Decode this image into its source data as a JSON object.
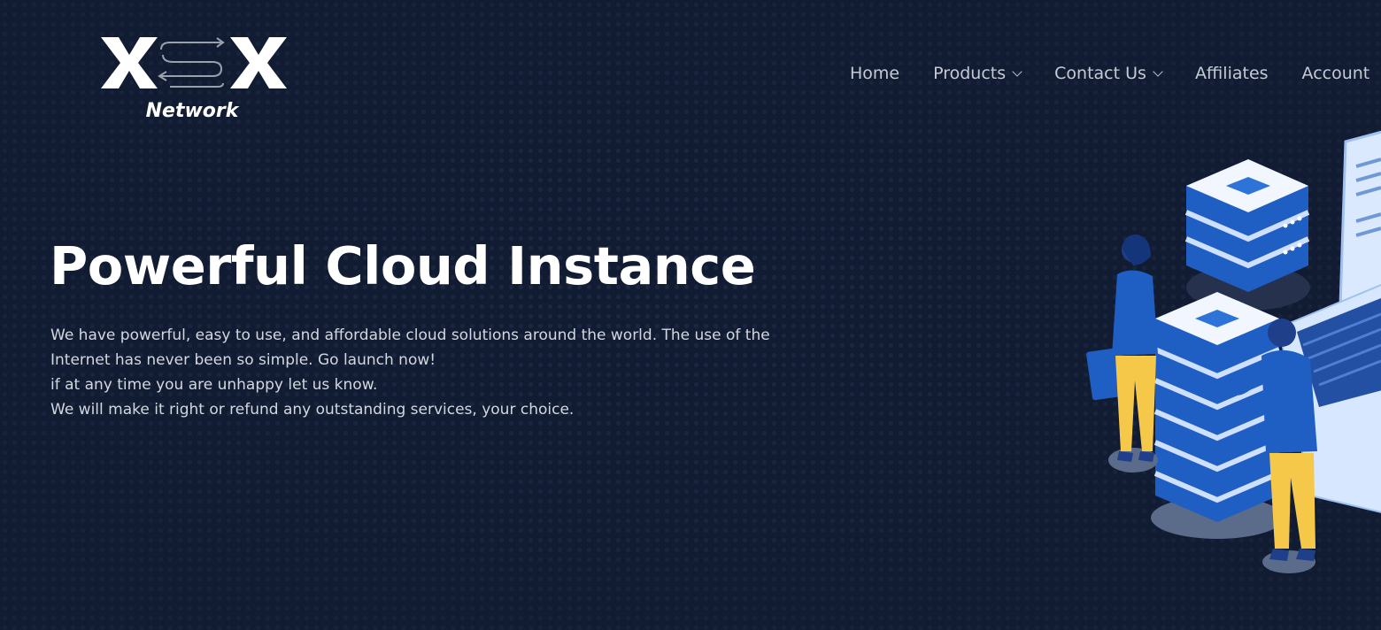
{
  "brand": {
    "name": "XSX",
    "tagline": "Network",
    "colors": {
      "logo": "#ffffff",
      "logo_arrows": "#9aa1ad"
    }
  },
  "nav": {
    "items": [
      {
        "label": "Home",
        "has_dropdown": false
      },
      {
        "label": "Products",
        "has_dropdown": true
      },
      {
        "label": "Contact Us",
        "has_dropdown": true
      },
      {
        "label": "Affiliates",
        "has_dropdown": false
      },
      {
        "label": "Account",
        "has_dropdown": false
      }
    ]
  },
  "hero": {
    "title": "Powerful Cloud Instance",
    "lines": [
      "We have powerful, easy to use, and affordable cloud solutions around the world. The use of the Internet has never been so simple. Go launch now!",
      "if at any time you are unhappy let us know.",
      "We will make it right or refund any outstanding services, your choice."
    ]
  },
  "theme": {
    "background": "#111b31",
    "dot_color": "#2e3f60",
    "nav_text": "#c5cad4",
    "title_text": "#ffffff",
    "body_text": "#d3d7df",
    "server_blue": "#1f5fc4",
    "figure_yellow": "#f5c84a"
  },
  "icons": {
    "dropdown": "chevron-down-icon",
    "illustration": "cloud-server-illustration"
  }
}
